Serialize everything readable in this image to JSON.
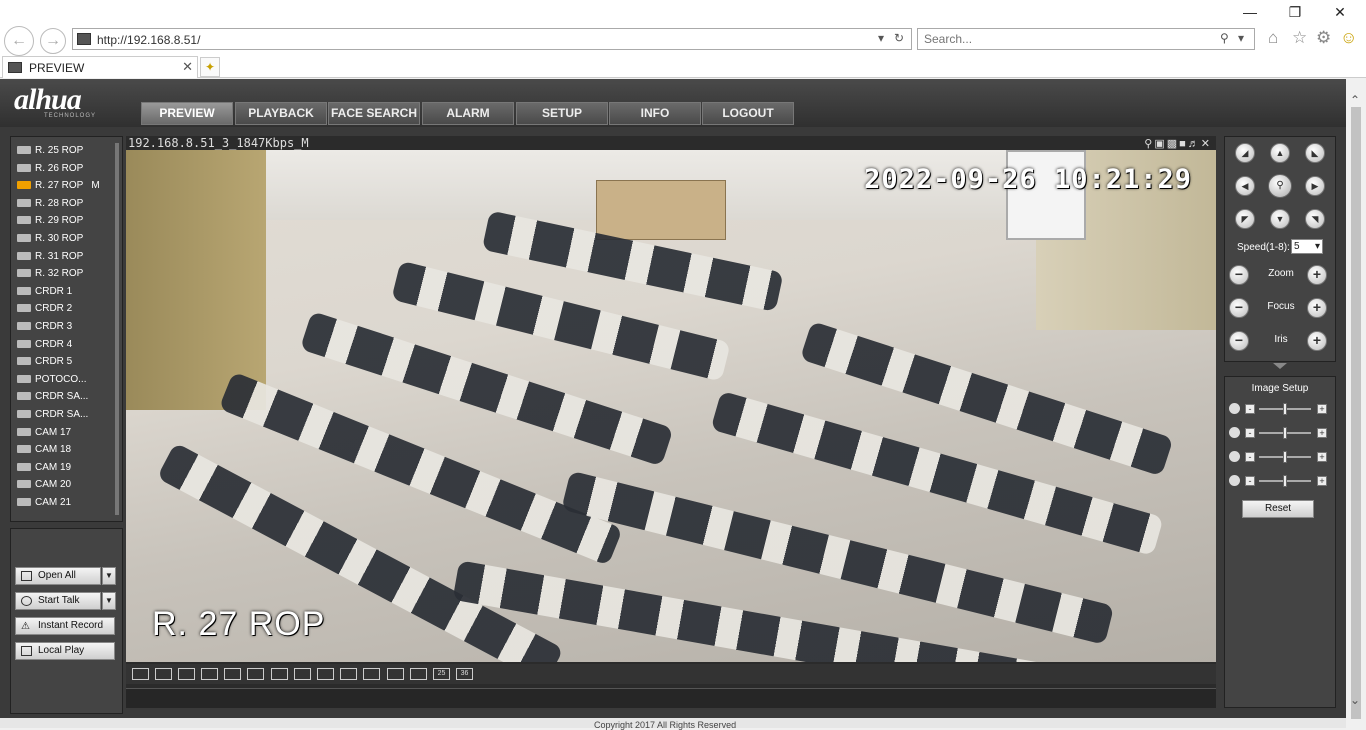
{
  "browser": {
    "url": "http://192.168.8.51/",
    "search_placeholder": "Search...",
    "tab_title": "PREVIEW",
    "icons": {
      "back": "back-arrow-icon",
      "forward": "forward-arrow-icon",
      "home": "home-icon",
      "favorites": "star-icon",
      "tools": "gear-icon",
      "feedback": "smiley-icon"
    }
  },
  "header": {
    "logo": "alhua",
    "logo_sub": "TECHNOLOGY",
    "menu": [
      {
        "label": "PREVIEW",
        "active": true
      },
      {
        "label": "PLAYBACK"
      },
      {
        "label": "FACE SEARCH"
      },
      {
        "label": "ALARM"
      },
      {
        "label": "SETUP"
      },
      {
        "label": "INFO"
      },
      {
        "label": "LOGOUT"
      }
    ]
  },
  "cameras": [
    {
      "name": "R. 25 ROP"
    },
    {
      "name": "R. 26 ROP"
    },
    {
      "name": "R. 27 ROP",
      "selected": true,
      "mark": "M"
    },
    {
      "name": "R. 28 ROP"
    },
    {
      "name": "R. 29 ROP"
    },
    {
      "name": "R. 30 ROP"
    },
    {
      "name": "R. 31 ROP"
    },
    {
      "name": "R. 32 ROP"
    },
    {
      "name": "CRDR 1"
    },
    {
      "name": "CRDR 2"
    },
    {
      "name": "CRDR 3"
    },
    {
      "name": "CRDR 4"
    },
    {
      "name": "CRDR 5"
    },
    {
      "name": "POTOCO..."
    },
    {
      "name": "CRDR SA..."
    },
    {
      "name": "CRDR SA..."
    },
    {
      "name": "CAM 17"
    },
    {
      "name": "CAM 18"
    },
    {
      "name": "CAM 19"
    },
    {
      "name": "CAM 20"
    },
    {
      "name": "CAM 21"
    }
  ],
  "actions": {
    "open_all": "Open All",
    "start_talk": "Start Talk",
    "instant_record": "Instant Record",
    "local_play": "Local Play"
  },
  "video": {
    "stream_title": "192.168.8.51_3_1847Kbps_M",
    "timestamp": "2022-09-26 10:21:29",
    "channel_label": "R. 27 ROP",
    "layouts": [
      "1",
      "2",
      "3",
      "4",
      "5",
      "6",
      "7",
      "8",
      "9",
      "10",
      "11",
      "12",
      "13",
      "25",
      "36"
    ]
  },
  "ptz": {
    "speed_label": "Speed(1-8):",
    "speed_value": "5",
    "zoom": "Zoom",
    "focus": "Focus",
    "iris": "Iris"
  },
  "image_setup": {
    "title": "Image Setup",
    "reset": "Reset",
    "sliders": [
      {
        "name": "brightness",
        "value": 0.5
      },
      {
        "name": "contrast",
        "value": 0.5
      },
      {
        "name": "saturation",
        "value": 0.5
      },
      {
        "name": "hue",
        "value": 0.5
      }
    ]
  },
  "footer": {
    "copyright": "Copyright 2017 All Rights Reserved"
  }
}
